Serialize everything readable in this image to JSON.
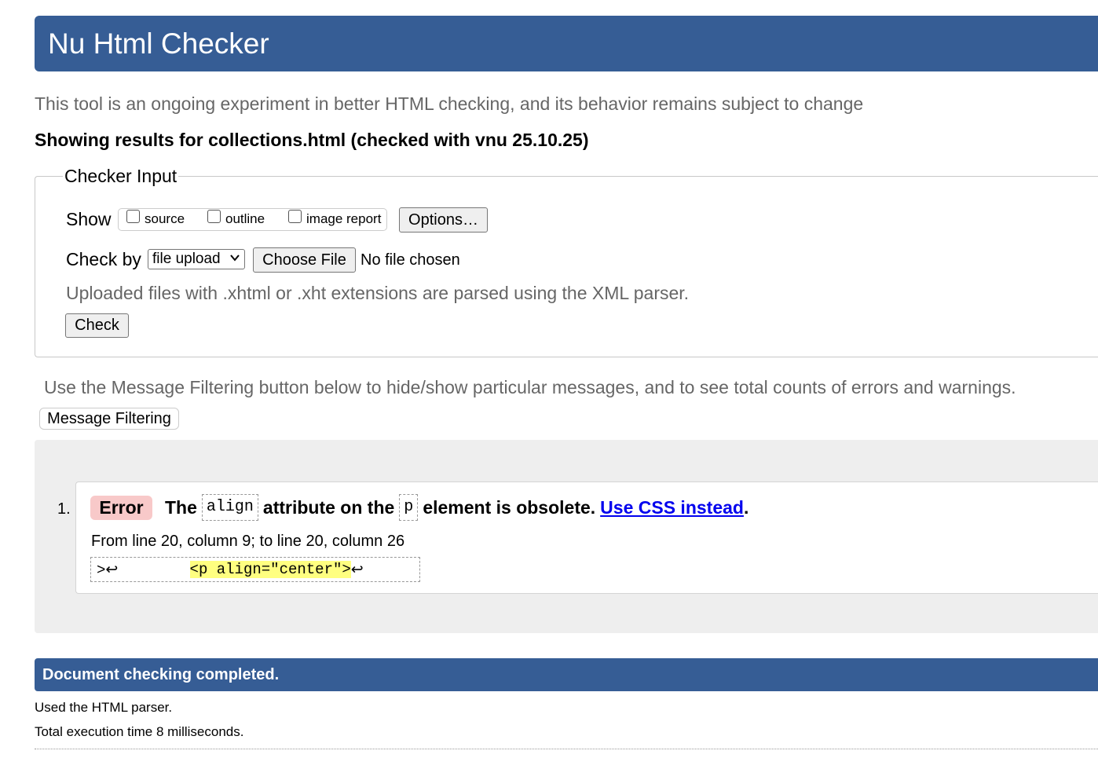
{
  "header": {
    "title": "Nu Html Checker"
  },
  "intro": "This tool is an ongoing experiment in better HTML checking, and its behavior remains subject to change",
  "results_for": "Showing results for collections.html (checked with vnu 25.10.25)",
  "checker_input": {
    "legend": "Checker Input",
    "show_label": "Show",
    "show_options": [
      {
        "label": "source",
        "checked": false
      },
      {
        "label": "outline",
        "checked": false
      },
      {
        "label": "image report",
        "checked": false
      }
    ],
    "options_button": "Options…",
    "check_by_label": "Check by",
    "check_by_value": "file upload",
    "choose_file_button": "Choose File",
    "no_file_text": "No file chosen",
    "xml_note": "Uploaded files with .xhtml or .xht extensions are parsed using the XML parser.",
    "check_button": "Check"
  },
  "filtering": {
    "text": "Use the Message Filtering button below to hide/show particular messages, and to see total counts of errors and warnings.",
    "button": "Message Filtering"
  },
  "messages": [
    {
      "number": "1.",
      "type": "Error",
      "text_parts": [
        "The",
        "align",
        "attribute on the",
        "p",
        "element is obsolete.",
        "Use CSS instead",
        "."
      ],
      "location": "From line 20, column 9; to line 20, column 26",
      "extract_before": ">↩        ",
      "extract_highlight": "<p align=\"center\">",
      "extract_after": "↩"
    }
  ],
  "completion": {
    "title": "Document checking completed.",
    "parser_note": "Used the HTML parser.",
    "execution_time": "Total execution time 8 milliseconds."
  },
  "colors": {
    "header_bg": "#365d95",
    "error_badge": "#f8c9c9",
    "highlight": "#ffff80",
    "link": "#0000ee"
  }
}
